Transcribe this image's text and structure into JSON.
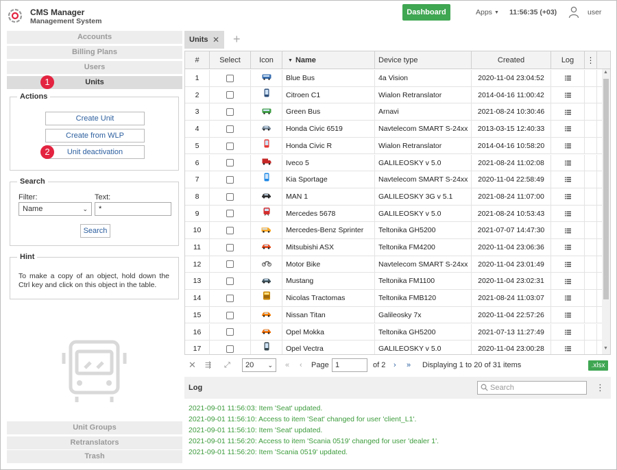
{
  "header": {
    "title": "CMS Manager",
    "subtitle": "Management System",
    "dashboard_label": "Dashboard",
    "apps_label": "Apps",
    "clock": "11:56:35 (+03)",
    "user": "user",
    "accent": "#3fa652"
  },
  "sidebar": {
    "nav_top": [
      "Accounts",
      "Billing Plans",
      "Users",
      "Units"
    ],
    "nav_bottom": [
      "Unit Groups",
      "Retranslators",
      "Trash"
    ],
    "active": "Units",
    "badges": [
      "1",
      "2"
    ],
    "actions_title": "Actions",
    "actions": [
      "Create Unit",
      "Create from WLP",
      "Unit deactivation"
    ],
    "search_title": "Search",
    "filter_label": "Filter:",
    "filter_value": "Name",
    "text_label": "Text:",
    "text_value": "*",
    "search_button": "Search",
    "hint_title": "Hint",
    "hint_text": "To make a copy of an object, hold down the Ctrl key and click on this object in the table."
  },
  "tabs": {
    "active_label": "Units"
  },
  "grid": {
    "columns": [
      "#",
      "Select",
      "Icon",
      "Name",
      "Device type",
      "Created",
      "Log"
    ],
    "rows": [
      {
        "n": "1",
        "icon": "bus-icon",
        "name": "Blue Bus",
        "device": "4a Vision",
        "created": "2020-11-04 23:04:52"
      },
      {
        "n": "2",
        "icon": "phone-icon",
        "name": "Citroen C1",
        "device": "Wialon Retranslator",
        "created": "2014-04-16 11:00:42"
      },
      {
        "n": "3",
        "icon": "bus-icon",
        "name": "Green Bus",
        "device": "Arnavi",
        "created": "2021-08-24 10:30:46"
      },
      {
        "n": "4",
        "icon": "car-icon",
        "name": "Honda Civic 6519",
        "device": "Navtelecom SMART S-24xx",
        "created": "2013-03-15 12:40:33"
      },
      {
        "n": "5",
        "icon": "phone-icon",
        "name": "Honda Civic R",
        "device": "Wialon Retranslator",
        "created": "2014-04-16 10:58:20"
      },
      {
        "n": "6",
        "icon": "truck-icon",
        "name": "Iveco 5",
        "device": "GALILEOSKY v 5.0",
        "created": "2021-08-24 11:02:08"
      },
      {
        "n": "7",
        "icon": "phone-icon",
        "name": "Kia Sportage",
        "device": "Navtelecom SMART S-24xx",
        "created": "2020-11-04 22:58:49"
      },
      {
        "n": "8",
        "icon": "car-icon",
        "name": "MAN 1",
        "device": "GALILEOSKY 3G v 5.1",
        "created": "2021-08-24 11:07:00"
      },
      {
        "n": "9",
        "icon": "tram-icon",
        "name": "Mercedes 5678",
        "device": "GALILEOSKY v 5.0",
        "created": "2021-08-24 10:53:43"
      },
      {
        "n": "10",
        "icon": "van-icon",
        "name": "Mercedes-Benz Sprinter",
        "device": "Teltonika GH5200",
        "created": "2021-07-07 14:47:30"
      },
      {
        "n": "11",
        "icon": "car-icon",
        "name": "Mitsubishi ASX",
        "device": "Teltonika FM4200",
        "created": "2020-11-04 23:06:36"
      },
      {
        "n": "12",
        "icon": "motorbike-icon",
        "name": "Motor Bike",
        "device": "Navtelecom SMART S-24xx",
        "created": "2020-11-04 23:01:49"
      },
      {
        "n": "13",
        "icon": "car-icon",
        "name": "Mustang",
        "device": "Teltonika FM1100",
        "created": "2020-11-04 23:02:31"
      },
      {
        "n": "14",
        "icon": "tractor-icon",
        "name": "Nicolas Tractomas",
        "device": "Teltonika FMB120",
        "created": "2021-08-24 11:03:07"
      },
      {
        "n": "15",
        "icon": "car-icon",
        "name": "Nissan Titan",
        "device": "Galileosky 7x",
        "created": "2020-11-04 22:57:26"
      },
      {
        "n": "16",
        "icon": "car-icon",
        "name": "Opel Mokka",
        "device": "Teltonika GH5200",
        "created": "2021-07-13 11:27:49"
      },
      {
        "n": "17",
        "icon": "phone-icon",
        "name": "Opel Vectra",
        "device": "GALILEOSKY v 5.0",
        "created": "2020-11-04 23:00:28"
      }
    ],
    "icon_colors": [
      "#3a6fb0",
      "#2e4f7a",
      "#43a047",
      "#7a8a99",
      "#e53935",
      "#c62828",
      "#1e88e5",
      "#333333",
      "#d32f2f",
      "#f9a825",
      "#e64a19",
      "#616161",
      "#455a64",
      "#c68400",
      "#f57c00",
      "#ef6c00",
      "#37474f"
    ]
  },
  "pager": {
    "page_size": "20",
    "page_label": "Page",
    "page_value": "1",
    "of_label": "of 2",
    "display": "Displaying 1 to 20 of 31 items",
    "export": ".xlsx"
  },
  "log": {
    "title": "Log",
    "search_placeholder": "Search",
    "lines": [
      "2021-09-01 11:56:03: Item 'Seat' updated.",
      "2021-09-01 11:56:10: Access to item 'Seat' changed for user 'client_L1'.",
      "2021-09-01 11:56:10: Item 'Seat' updated.",
      "2021-09-01 11:56:20: Access to item 'Scania 0519' changed for user 'dealer 1'.",
      "2021-09-01 11:56:20: Item 'Scania 0519' updated."
    ]
  }
}
